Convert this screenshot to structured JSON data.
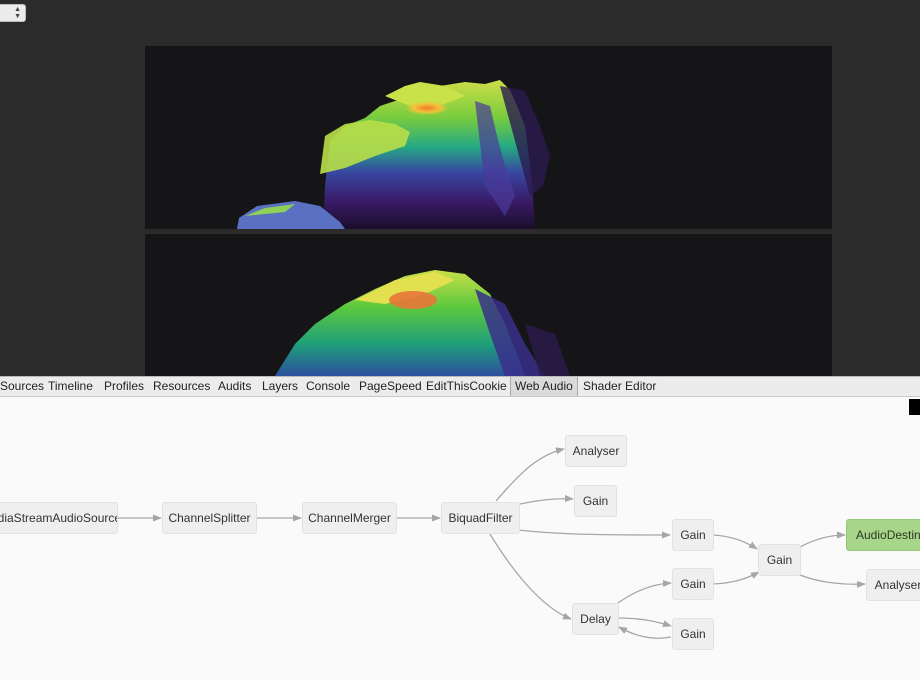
{
  "tabs": [
    {
      "label": "Sources",
      "active": false
    },
    {
      "label": "Timeline",
      "active": false
    },
    {
      "label": "Profiles",
      "active": false
    },
    {
      "label": "Resources",
      "active": false
    },
    {
      "label": "Audits",
      "active": false
    },
    {
      "label": "Layers",
      "active": false
    },
    {
      "label": "Console",
      "active": false
    },
    {
      "label": "PageSpeed",
      "active": false
    },
    {
      "label": "EditThisCookie",
      "active": false
    },
    {
      "label": "Web Audio",
      "active": true
    },
    {
      "label": "Shader Editor",
      "active": false
    }
  ],
  "graph": {
    "nodes": [
      {
        "id": "source",
        "label": "MediaStreamAudioSource"
      },
      {
        "id": "splitter",
        "label": "ChannelSplitter"
      },
      {
        "id": "merger",
        "label": "ChannelMerger"
      },
      {
        "id": "biquad",
        "label": "BiquadFilter"
      },
      {
        "id": "analyser1",
        "label": "Analyser"
      },
      {
        "id": "gain1",
        "label": "Gain"
      },
      {
        "id": "gain2",
        "label": "Gain"
      },
      {
        "id": "gain3",
        "label": "Gain"
      },
      {
        "id": "gain4",
        "label": "Gain"
      },
      {
        "id": "delay",
        "label": "Delay"
      },
      {
        "id": "gain5",
        "label": "Gain"
      },
      {
        "id": "destination",
        "label": "AudioDestination"
      },
      {
        "id": "analyser2",
        "label": "Analyser"
      }
    ],
    "edges": [
      [
        "source",
        "splitter"
      ],
      [
        "splitter",
        "merger"
      ],
      [
        "merger",
        "biquad"
      ],
      [
        "biquad",
        "analyser1"
      ],
      [
        "biquad",
        "gain1"
      ],
      [
        "biquad",
        "gain2"
      ],
      [
        "biquad",
        "delay"
      ],
      [
        "gain2",
        "gain4"
      ],
      [
        "gain3",
        "gain4"
      ],
      [
        "gain4",
        "destination"
      ],
      [
        "gain4",
        "analyser2"
      ],
      [
        "delay",
        "gain3"
      ],
      [
        "delay",
        "gain5"
      ],
      [
        "gain5",
        "delay"
      ]
    ]
  },
  "colors": {
    "node_bg": "#efefef",
    "destination_bg": "#a7d58a",
    "edge": "#a6a6a6",
    "panel_bg": "#fafafa",
    "viz_bg": "#151517"
  }
}
